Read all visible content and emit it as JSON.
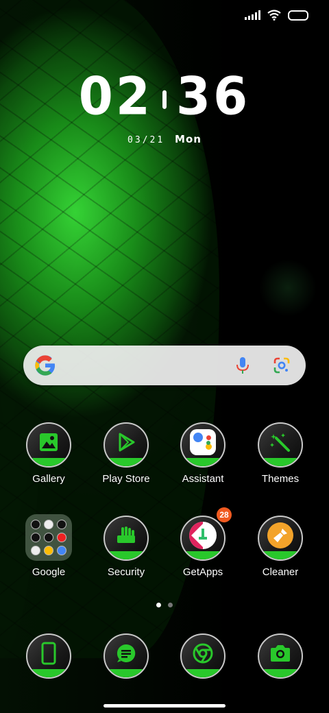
{
  "status_bar": {
    "icons": [
      "signal-icon",
      "wifi-icon",
      "battery-icon"
    ]
  },
  "lockclock": {
    "hours": "02",
    "minutes": "36",
    "date": "03/21",
    "day": "Mon"
  },
  "search_bar": {
    "icons": [
      "google-g-icon",
      "microphone-icon",
      "google-lens-icon"
    ]
  },
  "apps_row1": [
    {
      "label": "Gallery",
      "icon": "gallery-icon"
    },
    {
      "label": "Play Store",
      "icon": "play-store-icon"
    },
    {
      "label": "Assistant",
      "icon": "assistant-icon"
    },
    {
      "label": "Themes",
      "icon": "themes-icon"
    }
  ],
  "apps_row2": [
    {
      "label": "Google",
      "icon": "google-folder-icon"
    },
    {
      "label": "Security",
      "icon": "security-icon"
    },
    {
      "label": "GetApps",
      "icon": "getapps-icon",
      "badge": "28"
    },
    {
      "label": "Cleaner",
      "icon": "cleaner-icon"
    }
  ],
  "page_indicator": {
    "pages": 2,
    "current": 1
  },
  "dock": [
    {
      "icon": "phone-icon"
    },
    {
      "icon": "messages-icon"
    },
    {
      "icon": "chrome-icon"
    },
    {
      "icon": "camera-icon"
    }
  ],
  "colors": {
    "accent_green": "#29c82b",
    "badge_orange": "#f05a20"
  }
}
